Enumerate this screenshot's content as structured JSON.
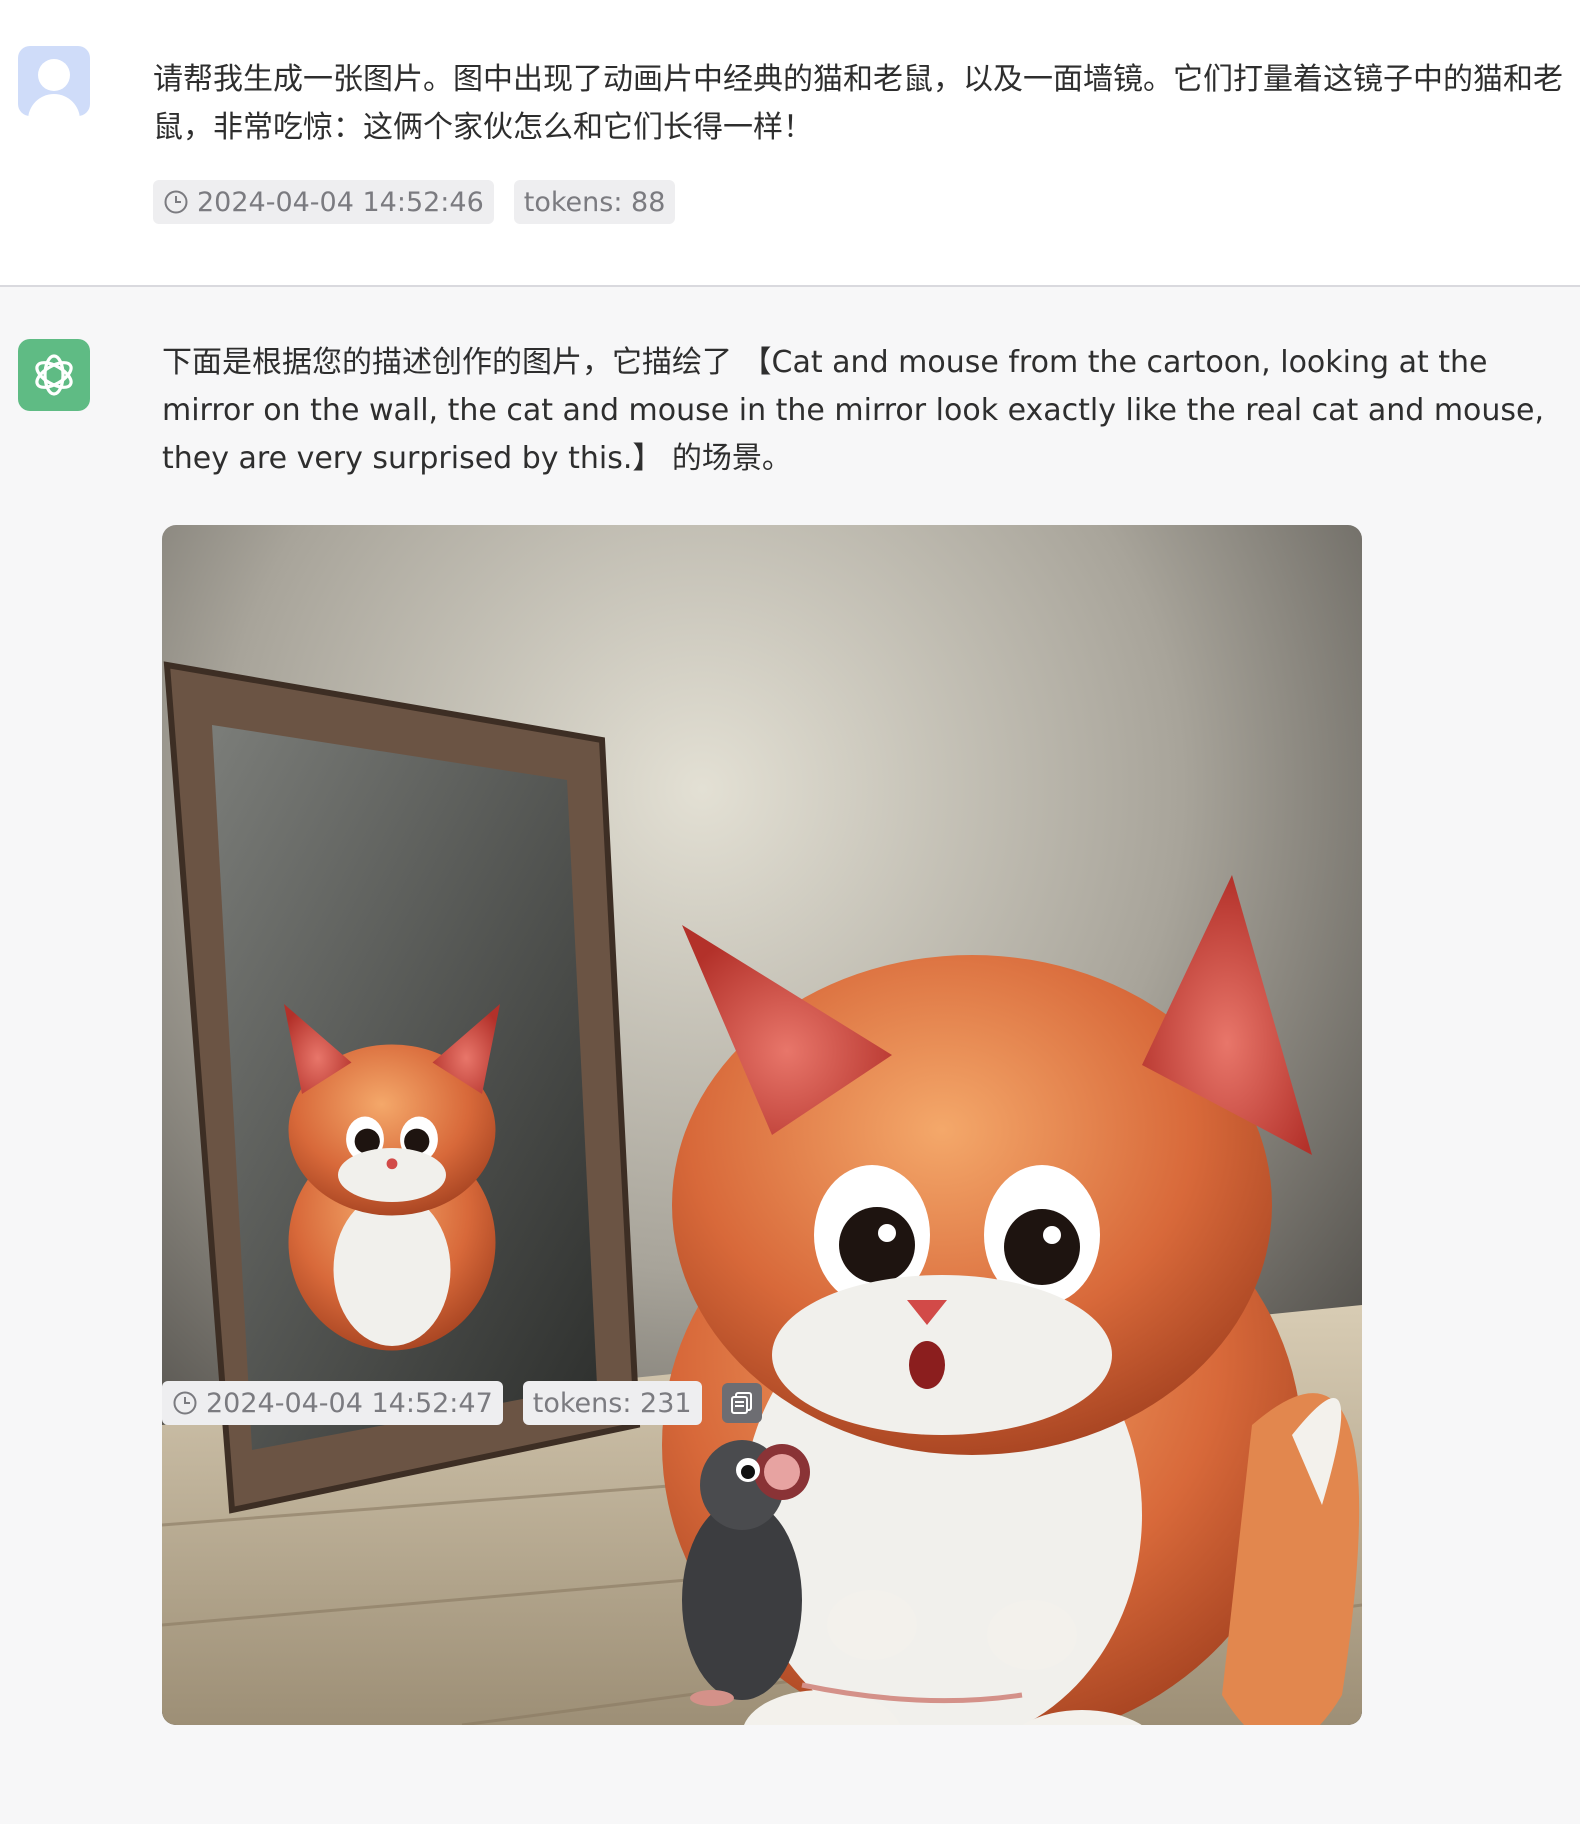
{
  "user_message": {
    "avatar": "user-avatar-icon",
    "text": "请帮我生成一张图片。图中出现了动画片中经典的猫和老鼠，以及一面墙镜。它们打量着这镜子中的猫和老鼠，非常吃惊：这俩个家伙怎么和它们长得一样！",
    "timestamp": "2024-04-04 14:52:46",
    "tokens": "tokens: 88"
  },
  "assistant_message": {
    "avatar": "openai-logo-icon",
    "text": "下面是根据您的描述创作的图片，它描绘了 【Cat and mouse from the cartoon, looking at the mirror on the wall, the cat and mouse in the mirror look exactly like the real cat and mouse, they are very surprised by this.】 的场景。",
    "timestamp": "2024-04-04 14:52:47",
    "tokens": "tokens: 231",
    "copy_icon": "copy-icon"
  },
  "colors": {
    "user_bg": "#ffffff",
    "assistant_bg": "#f7f7f8",
    "user_avatar": "#cfdcf9",
    "assistant_avatar": "#5fbb84",
    "chip_bg": "#eeeef0",
    "chip_text": "#7b7b80"
  }
}
